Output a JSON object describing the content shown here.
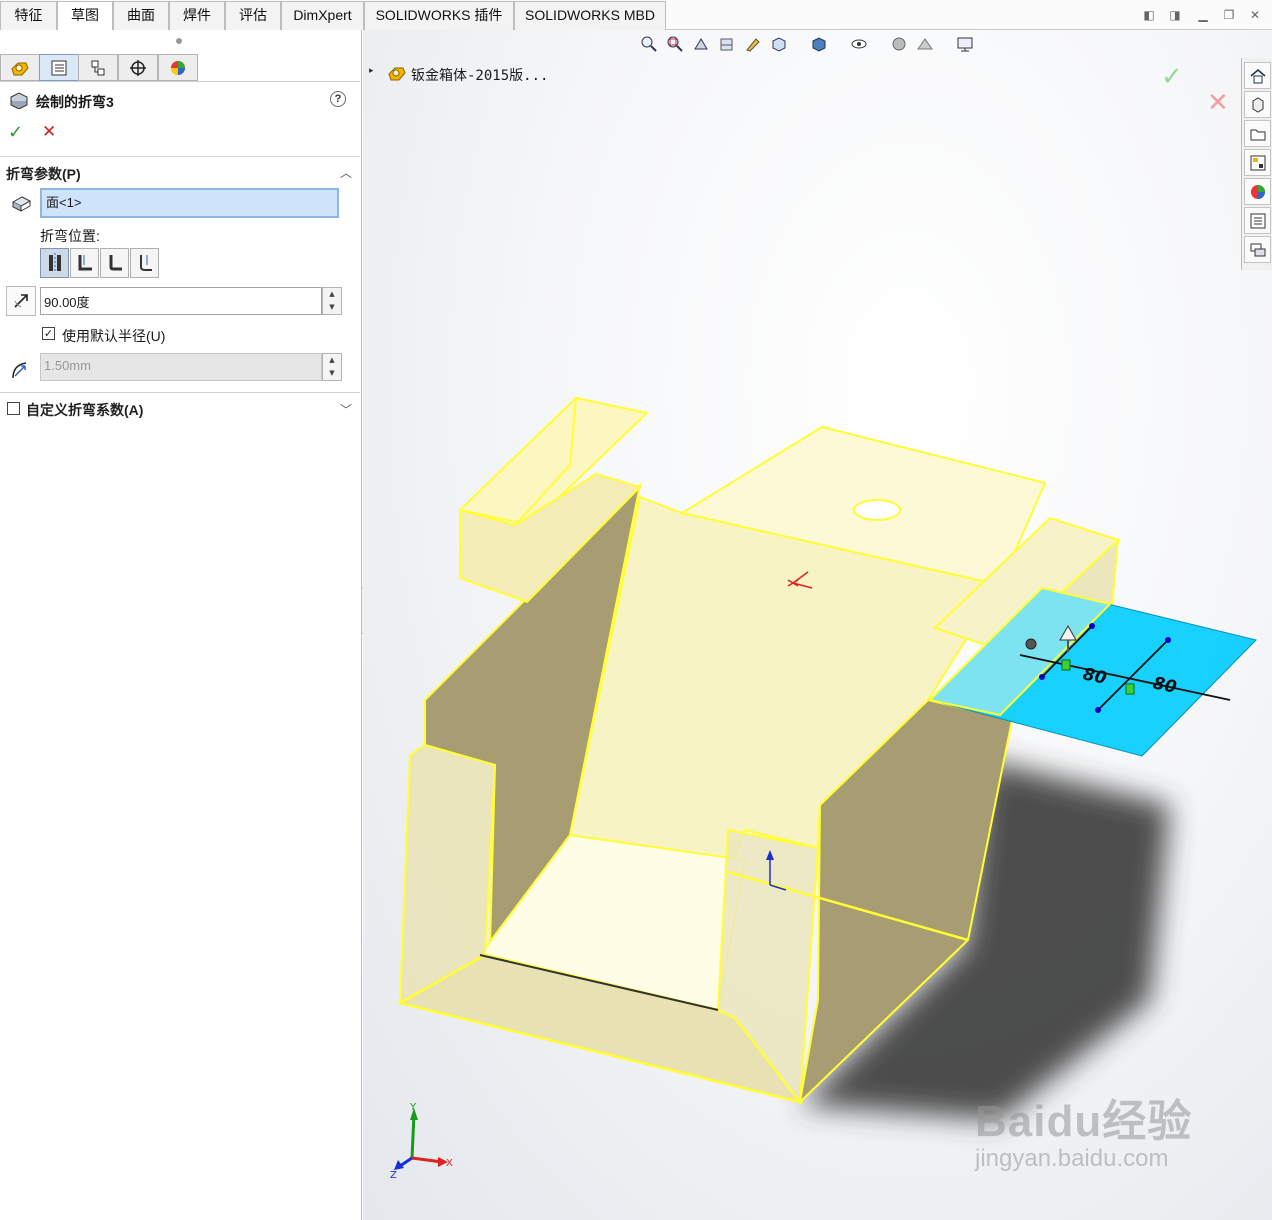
{
  "tabs": [
    {
      "label": "特征",
      "active": false
    },
    {
      "label": "草图",
      "active": true
    },
    {
      "label": "曲面",
      "active": false
    },
    {
      "label": "焊件",
      "active": false
    },
    {
      "label": "评估",
      "active": false
    },
    {
      "label": "DimXpert",
      "active": false
    },
    {
      "label": "SOLIDWORKS 插件",
      "active": false
    },
    {
      "label": "SOLIDWORKS MBD",
      "active": false
    }
  ],
  "property_manager": {
    "title": "绘制的折弯3",
    "help": "?",
    "ok": "✓",
    "cancel": "✕",
    "bend_params": {
      "header": "折弯参数(P)",
      "face_selection": "面<1>",
      "bend_position_label": "折弯位置:",
      "bend_position_options": [
        "材料在内",
        "材料在外",
        "折弯向外",
        "折弯中心线"
      ],
      "bend_angle": "90.00度",
      "use_default_radius": {
        "label": "使用默认半径(U)",
        "checked": true
      },
      "radius": "1.50mm"
    },
    "custom_bend_allowance": {
      "label": "自定义折弯系数(A)",
      "checked": false
    }
  },
  "tree": {
    "arrow": "▸",
    "part_name": "钣金箱体-2015版..."
  },
  "viewport": {
    "dimension_1": "80",
    "dimension_2": "80",
    "triad": {
      "x": "X",
      "y": "Y",
      "z": "Z"
    }
  },
  "watermark": {
    "logo": "Baidu经验",
    "url": "jingyan.baidu.com"
  },
  "colors": {
    "selection_yellow": "#ffff33",
    "sketch_plane": "#00ccff",
    "ok_green": "#2a9a2a",
    "cancel_red": "#d32020"
  },
  "icons": {
    "taskpane": [
      "home-icon",
      "3d-parts-icon",
      "folder-icon",
      "view-palette-icon",
      "appearance-icon",
      "custom-properties-icon",
      "forum-icon"
    ]
  }
}
